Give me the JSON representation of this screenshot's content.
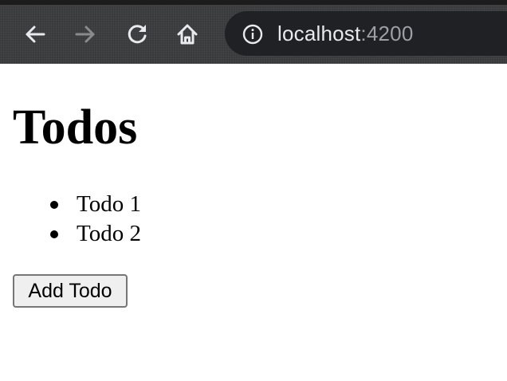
{
  "browser": {
    "url_host": "localhost",
    "url_port": ":4200",
    "icons": {
      "back": "back-arrow-icon",
      "forward": "forward-arrow-icon",
      "reload": "reload-icon",
      "home": "home-icon",
      "site_info": "info-icon"
    },
    "colors": {
      "toolbar": "#3a3b3d",
      "address_bar": "#202124",
      "url_host": "#e8eaed",
      "url_port": "#9aa0a6"
    }
  },
  "page": {
    "title": "Todos",
    "todos": [
      {
        "label": "Todo 1"
      },
      {
        "label": "Todo 2"
      }
    ],
    "add_button_label": "Add Todo"
  }
}
